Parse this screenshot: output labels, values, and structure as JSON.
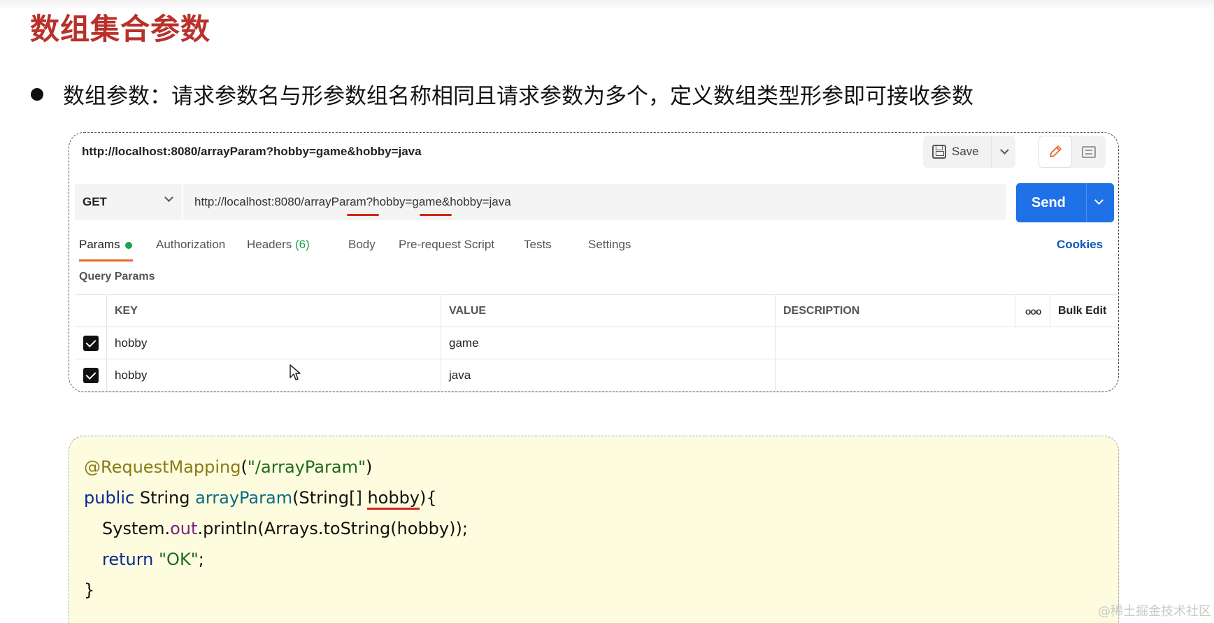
{
  "slide": {
    "title": "数组集合参数",
    "bullet": "数组参数：请求参数名与形参数组名称相同且请求参数为多个，定义数组类型形参即可接收参数"
  },
  "postman": {
    "request_name": "http://localhost:8080/arrayParam?hobby=game&hobby=java",
    "save_label": "Save",
    "method": "GET",
    "url": "http://localhost:8080/arrayParam?hobby=game&hobby=java",
    "send_label": "Send",
    "tabs": [
      {
        "label": "Params",
        "active": true
      },
      {
        "label": "Authorization"
      },
      {
        "label": "Headers",
        "count": "(6)"
      },
      {
        "label": "Body"
      },
      {
        "label": "Pre-request Script"
      },
      {
        "label": "Tests"
      },
      {
        "label": "Settings"
      }
    ],
    "cookies_label": "Cookies",
    "query_params_label": "Query Params",
    "table": {
      "columns": [
        "KEY",
        "VALUE",
        "DESCRIPTION"
      ],
      "more_icon": "ooo",
      "bulk_edit_label": "Bulk Edit",
      "rows": [
        {
          "checked": true,
          "key": "hobby",
          "value": "game",
          "description": ""
        },
        {
          "checked": true,
          "key": "hobby",
          "value": "java",
          "description": ""
        }
      ]
    },
    "colors": {
      "send": "#1f71e8",
      "active_tab": "#e9662d",
      "highlight": "#d4251c"
    }
  },
  "code": {
    "l1_annotation": "@RequestMapping",
    "l1_open": "(",
    "l1_string": "\"/arrayParam\"",
    "l1_close": ")",
    "l2_public": "public",
    "l2_type": " String ",
    "l2_method": "arrayParam",
    "l2_args": "(String[] ",
    "l2_param": "hobby",
    "l2_end": "){",
    "l3_pre": "System.",
    "l3_field": "out",
    "l3_post": ".println(Arrays.toString(hobby));",
    "l4_return": "return",
    "l4_string": " \"OK\"",
    "l4_end": ";",
    "l5": "}"
  },
  "watermark": "@稀土掘金技术社区"
}
